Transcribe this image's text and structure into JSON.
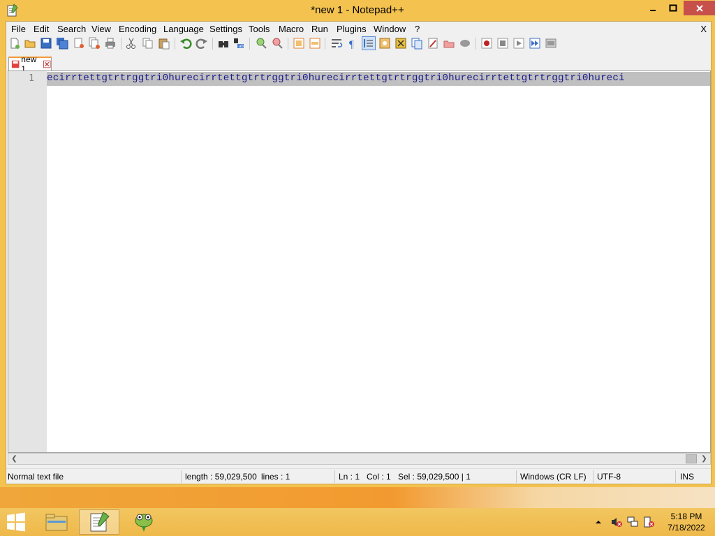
{
  "window": {
    "title": "*new 1 - Notepad++",
    "minimize_symbol": "–",
    "close_symbol": "✕"
  },
  "menu": {
    "items": [
      "File",
      "Edit",
      "Search",
      "View",
      "Encoding",
      "Language",
      "Settings",
      "Tools",
      "Macro",
      "Run",
      "Plugins",
      "Window",
      "?"
    ],
    "close_label": "X"
  },
  "toolbar": {
    "icons": [
      "new-file-icon",
      "open-file-icon",
      "save-icon",
      "save-all-icon",
      "close-icon",
      "close-all-icon",
      "print-icon",
      "cut-icon",
      "copy-icon",
      "paste-icon",
      "undo-icon",
      "redo-icon",
      "find-icon",
      "replace-icon",
      "zoom-in-icon",
      "zoom-out-icon",
      "sync-vertical-icon",
      "sync-horizontal-icon",
      "word-wrap-icon",
      "show-all-chars-icon",
      "indent-guide-icon",
      "user-defined-language-icon",
      "document-map-icon",
      "function-list-icon",
      "folder-as-workspace-icon",
      "monitoring-icon",
      "record-macro-icon",
      "stop-record-icon",
      "playback-icon",
      "run-macro-multiple-icon",
      "save-macro-icon"
    ]
  },
  "tab": {
    "label": "new 1"
  },
  "editor": {
    "line_number": "1",
    "line_text": "ecirrtettgtrtrggtri0hurecirrtettgtrtrggtri0hurecirrtettgtrtrggtri0hurecirrtettgtrtrggtri0hureci"
  },
  "status": {
    "file_type": "Normal text file",
    "length": "length : 59,029,500",
    "lines": "lines : 1",
    "ln": "Ln : 1",
    "col": "Col : 1",
    "sel": "Sel : 59,029,500 | 1",
    "eol": "Windows (CR LF)",
    "encoding": "UTF-8",
    "mode": "INS"
  },
  "taskbar": {
    "time": "5:18 PM",
    "date": "7/18/2022"
  },
  "colors": {
    "accent": "#f3c24f",
    "close_button": "#c7504b",
    "text_blue": "#1a1a8c",
    "selection_gray": "#c0c0c0"
  }
}
